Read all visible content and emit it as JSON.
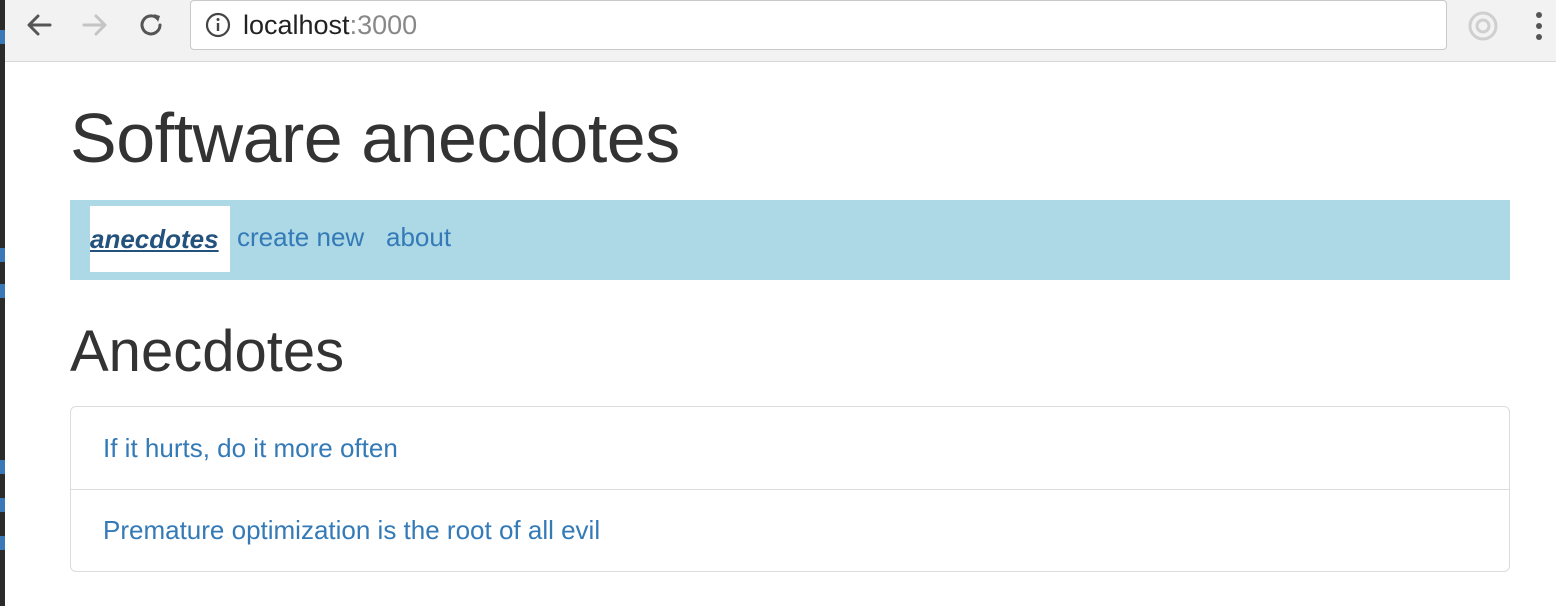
{
  "browser": {
    "url_host": "localhost",
    "url_port": ":3000"
  },
  "page": {
    "title": "Software anecdotes",
    "menu": {
      "active_label": "anecdotes",
      "create_label": "create new",
      "about_label": "about"
    },
    "section_title": "Anecdotes",
    "anecdotes": [
      {
        "text": "If it hurts, do it more often"
      },
      {
        "text": "Premature optimization is the root of all evil"
      }
    ]
  },
  "colors": {
    "navbar_bg": "#add8e6",
    "link": "#337ab7",
    "active_link": "#23527c",
    "heading": "#333333"
  }
}
